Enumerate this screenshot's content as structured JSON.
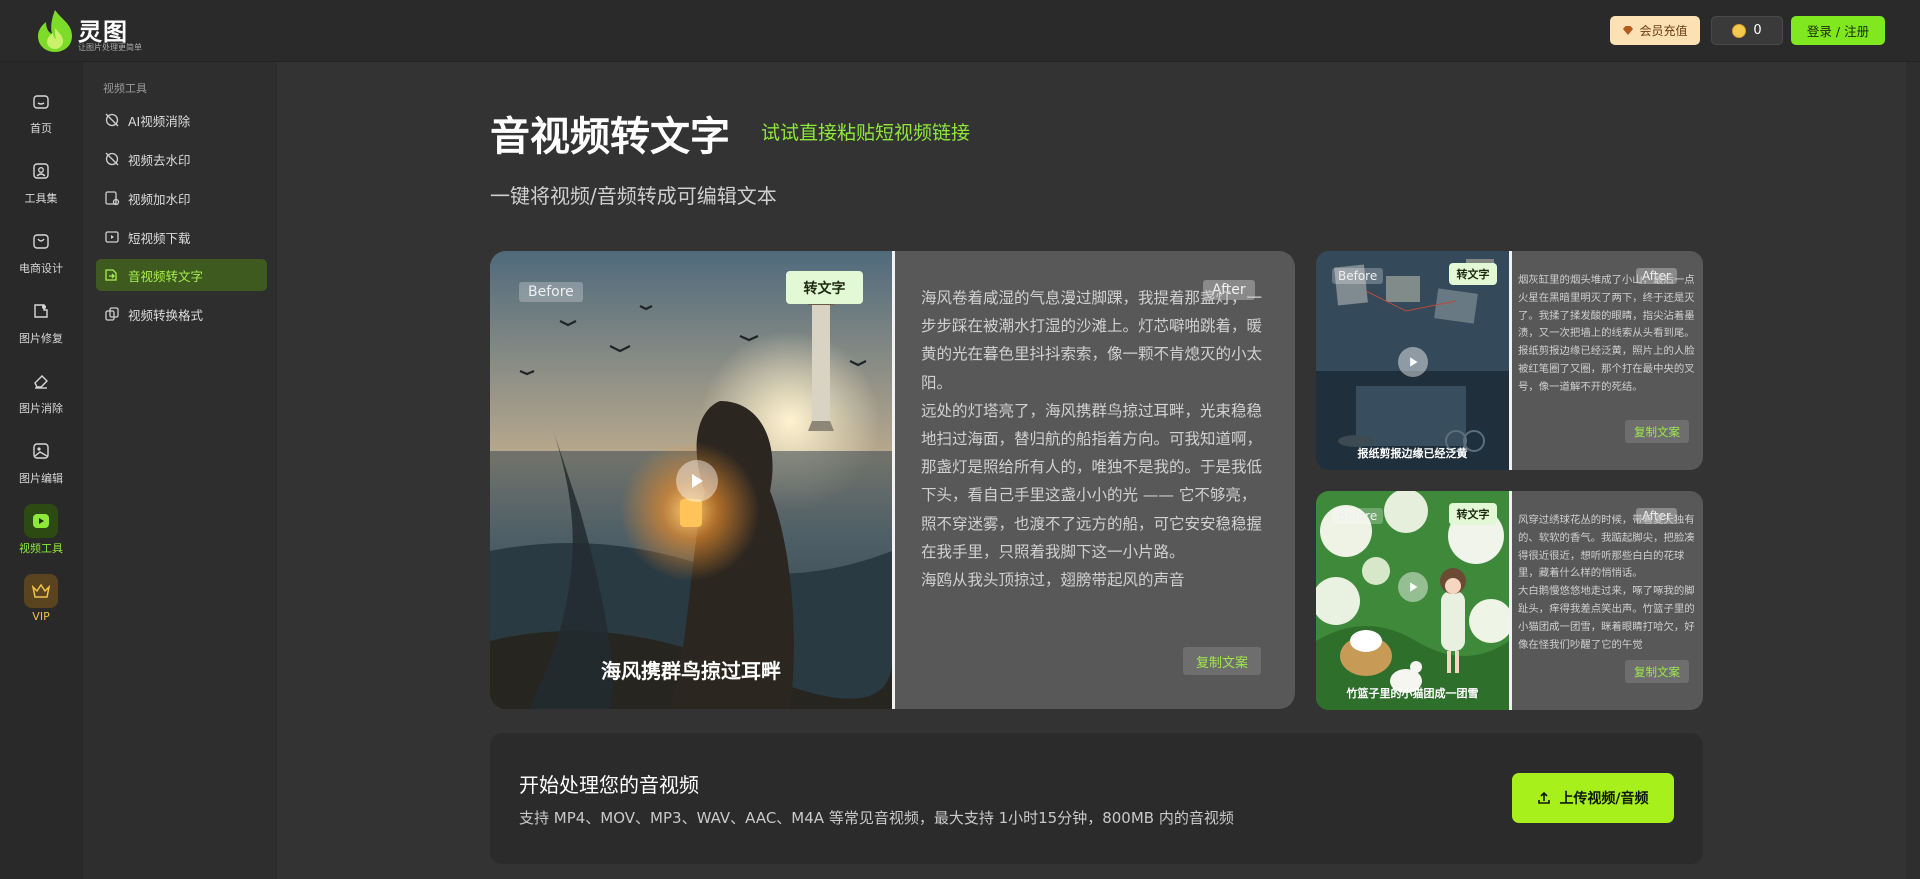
{
  "brand": {
    "name": "灵图",
    "slogan": "让图片处理更简单"
  },
  "header": {
    "vip_label": "会员充值",
    "coin_count": "0",
    "login_label": "登录 / 注册"
  },
  "rail": [
    {
      "label": "首页",
      "icon": "home-icon"
    },
    {
      "label": "工具集",
      "icon": "toolbox-icon"
    },
    {
      "label": "电商设计",
      "icon": "shopping-bag-icon"
    },
    {
      "label": "图片修复",
      "icon": "image-repair-icon"
    },
    {
      "label": "图片消除",
      "icon": "eraser-icon"
    },
    {
      "label": "图片编辑",
      "icon": "image-edit-icon"
    },
    {
      "label": "视频工具",
      "icon": "video-icon"
    },
    {
      "label": "VIP",
      "icon": "crown-icon"
    }
  ],
  "subnav": {
    "title": "视频工具",
    "items": [
      {
        "label": "AI视频消除",
        "icon": "ai-eraser-icon"
      },
      {
        "label": "视频去水印",
        "icon": "remove-watermark-icon"
      },
      {
        "label": "视频加水印",
        "icon": "add-watermark-icon"
      },
      {
        "label": "短视频下载",
        "icon": "video-download-icon"
      },
      {
        "label": "音视频转文字",
        "icon": "transcribe-icon"
      },
      {
        "label": "视频转换格式",
        "icon": "convert-format-icon"
      }
    ]
  },
  "main": {
    "title": "音视频转文字",
    "hint": "试试直接粘贴短视频链接",
    "subtitle": "一键将视频/音频转成可编辑文本"
  },
  "demo_main": {
    "before_label": "Before",
    "after_label": "After",
    "tag": "转文字",
    "caption": "海风携群鸟掠过耳畔",
    "paragraphs": [
      "海风卷着咸湿的气息漫过脚踝，我提着那盏灯，一步步踩在被潮水打湿的沙滩上。灯芯噼啪跳着，暖黄的光在暮色里抖抖索索，像一颗不肯熄灭的小太阳。",
      "远处的灯塔亮了，海风携群鸟掠过耳畔，光束稳稳地扫过海面，替归航的船指着方向。可我知道啊，那盏灯是照给所有人的，唯独不是我的。于是我低下头，看自己手里这盏小小的光 —— 它不够亮，照不穿迷雾，也渡不了远方的船，可它安安稳稳握在我手里，只照着我脚下这一小片路。",
      "海鸥从我头顶掠过，翅膀带起风的声音"
    ],
    "copy_label": "复制文案"
  },
  "demo_small": [
    {
      "before_label": "Before",
      "after_label": "After",
      "tag": "转文字",
      "caption": "报纸剪报边缘已经泛黄",
      "paragraphs": [
        "烟灰缸里的烟头堆成了小山，最后一点火星在黑暗里明灭了两下，终于还是灭了。我揉了揉发酸的眼睛，指尖沾着墨渍，又一次把墙上的线索从头看到尾。",
        "报纸剪报边缘已经泛黄，照片上的人脸被红笔圈了又圈，那个打在最中央的叉号，像一道解不开的死结。"
      ],
      "copy_label": "复制文案"
    },
    {
      "before_label": "Before",
      "after_label": "After",
      "tag": "转文字",
      "caption": "竹篮子里的小猫团成一团雪",
      "paragraphs": [
        "风穿过绣球花丛的时候，带着夏天独有的、软软的香气。我踮起脚尖，把脸凑得很近很近，想听听那些白白的花球里，藏着什么样的悄悄话。",
        "大白鹅慢悠悠地走过来，啄了啄我的脚趾头，痒得我差点笑出声。竹篮子里的小猫团成一团雪，眯着眼睛打哈欠，好像在怪我们吵醒了它的午觉"
      ],
      "copy_label": "复制文案"
    }
  ],
  "upload": {
    "title": "开始处理您的音视频",
    "desc": "支持 MP4、MOV、MP3、WAV、AAC、M4A 等常见音视频，最大支持 1小时15分钟，800MB 内的音视频",
    "button_label": "上传视频/音频"
  },
  "colors": {
    "accent": "#8ee83a",
    "button_green": "#a7f01c",
    "vip": "#fbe1b4"
  }
}
